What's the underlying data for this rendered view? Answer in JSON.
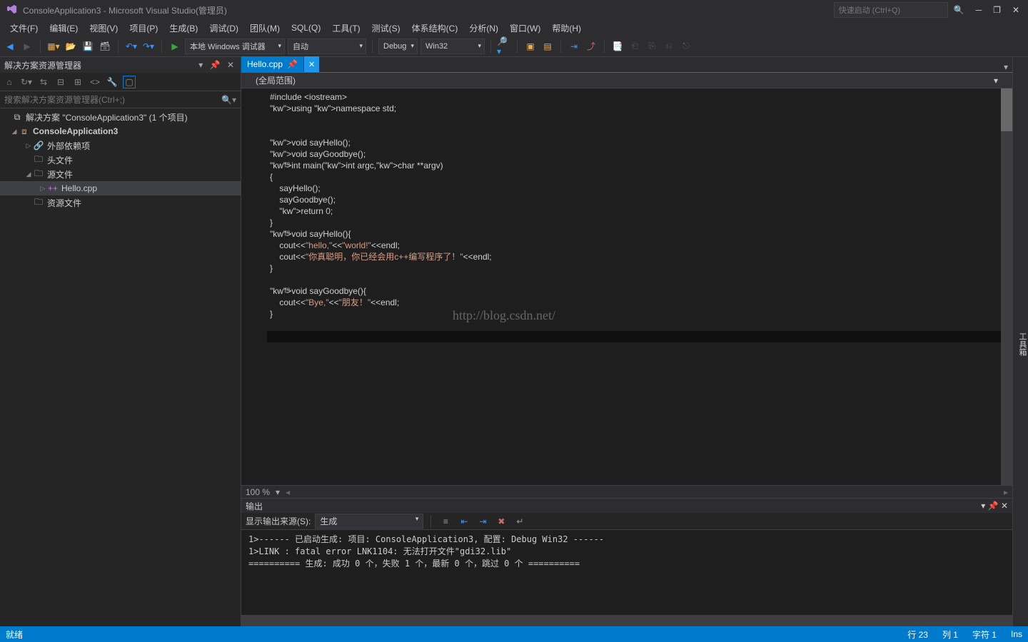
{
  "title": "ConsoleApplication3 - Microsoft Visual Studio(管理员)",
  "quicklaunch": "快速启动 (Ctrl+Q)",
  "menu": [
    "文件(F)",
    "编辑(E)",
    "视图(V)",
    "项目(P)",
    "生成(B)",
    "调试(D)",
    "团队(M)",
    "SQL(Q)",
    "工具(T)",
    "测试(S)",
    "体系结构(C)",
    "分析(N)",
    "窗口(W)",
    "帮助(H)"
  ],
  "toolbar": {
    "debugger": "本地 Windows 调试器",
    "auto": "自动",
    "config": "Debug",
    "platform": "Win32"
  },
  "solution_explorer": {
    "title": "解决方案资源管理器",
    "search_ph": "搜索解决方案资源管理器(Ctrl+;)",
    "solution": "解决方案 \"ConsoleApplication3\" (1 个项目)",
    "project": "ConsoleApplication3",
    "nodes": {
      "ext": "外部依赖项",
      "headers": "头文件",
      "sources": "源文件",
      "hello": "Hello.cpp",
      "resources": "资源文件"
    }
  },
  "tab": {
    "name": "Hello.cpp"
  },
  "scope": "(全局范围)",
  "code_lines": [
    {
      "t": "#include <iostream>",
      "cls": "pp inc"
    },
    {
      "t": "using namespace std;",
      "cls": "kw-line"
    },
    {
      "t": ""
    },
    {
      "t": ""
    },
    {
      "t": "void sayHello();",
      "cls": "decl"
    },
    {
      "t": "void sayGoodbye();",
      "cls": "decl"
    },
    {
      "t": "int main(int argc,char **argv)",
      "fold": true,
      "cls": "sig"
    },
    {
      "t": "{"
    },
    {
      "t": "    sayHello();"
    },
    {
      "t": "    sayGoodbye();"
    },
    {
      "t": "    return 0;",
      "cls": "ret"
    },
    {
      "t": "}"
    },
    {
      "t": "void sayHello(){",
      "fold": true,
      "cls": "sig"
    },
    {
      "t": "    cout<<\"hello,\"<<\"world!\"<<endl;",
      "cls": "str-line"
    },
    {
      "t": "    cout<<\"你真聪明，你已经会用c++编写程序了！\"<<endl;",
      "cls": "str-line"
    },
    {
      "t": "}"
    },
    {
      "t": ""
    },
    {
      "t": "void sayGoodbye(){",
      "fold": true,
      "cls": "sig"
    },
    {
      "t": "    cout<<\"Bye,\"<<\"朋友！\"<<endl;",
      "cls": "str-line"
    },
    {
      "t": "}"
    }
  ],
  "watermark": "http://blog.csdn.net/",
  "zoom": "100 %",
  "output": {
    "title": "输出",
    "from_label": "显示输出来源(S):",
    "from_value": "生成",
    "lines": [
      "1>------ 已启动生成: 项目: ConsoleApplication3, 配置: Debug Win32 ------",
      "1>LINK : fatal error LNK1104: 无法打开文件\"gdi32.lib\"",
      "========== 生成: 成功 0 个，失败 1 个，最新 0 个，跳过 0 个 =========="
    ]
  },
  "rightstrip": "工具箱",
  "status": {
    "ready": "就绪",
    "line": "行 23",
    "col": "列 1",
    "ch": "字符 1",
    "ins": "Ins"
  }
}
